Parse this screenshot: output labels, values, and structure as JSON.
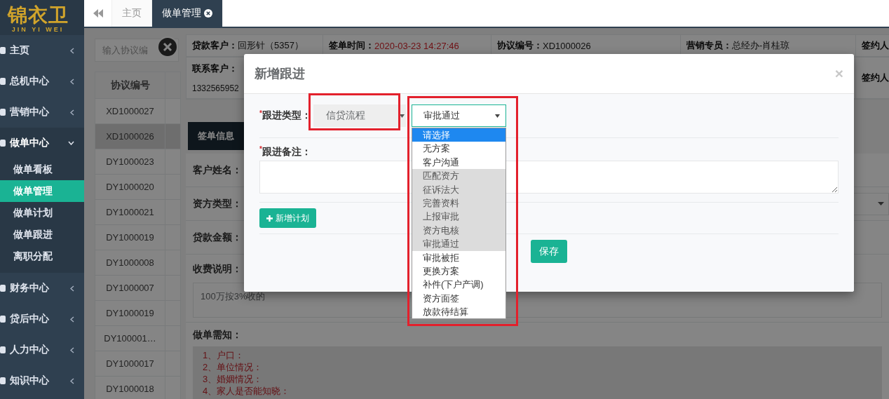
{
  "sidebar": {
    "logo": {
      "title": "锦衣卫",
      "subtitle": "JIN YI WEI"
    },
    "items": [
      {
        "label": "主页",
        "expanded": false
      },
      {
        "label": "总机中心",
        "expanded": false
      },
      {
        "label": "营销中心",
        "expanded": false
      },
      {
        "label": "做单中心",
        "expanded": true,
        "children": [
          {
            "label": "做单看板",
            "selected": false
          },
          {
            "label": "做单管理",
            "selected": true
          },
          {
            "label": "做单计划",
            "selected": false
          },
          {
            "label": "做单跟进",
            "selected": false
          },
          {
            "label": "离职分配",
            "selected": false
          }
        ]
      },
      {
        "label": "财务中心",
        "expanded": false
      },
      {
        "label": "贷后中心",
        "expanded": false
      },
      {
        "label": "人力中心",
        "expanded": false
      },
      {
        "label": "知识中心",
        "expanded": false
      }
    ]
  },
  "tabs": [
    {
      "label": "主页",
      "selected": false,
      "closable": false
    },
    {
      "label": "做单管理",
      "selected": true,
      "closable": true
    }
  ],
  "order_list": {
    "search": {
      "placeholder": "输入协议编"
    },
    "columns": [
      "协议编号"
    ],
    "rows": [
      {
        "number": "XD1000027",
        "selected": false
      },
      {
        "number": "XD1000026",
        "selected": true
      },
      {
        "number": "DY1000023",
        "selected": false
      },
      {
        "number": "DY1000020",
        "selected": false
      },
      {
        "number": "DY1000021",
        "selected": false
      },
      {
        "number": "DY1000019",
        "selected": false
      },
      {
        "number": "DY1000008",
        "selected": false
      },
      {
        "number": "DY1000007",
        "selected": false
      },
      {
        "number": "DY1000019",
        "selected": false
      },
      {
        "number": "DY100001…",
        "selected": false
      },
      {
        "number": "DY1000017",
        "selected": false
      },
      {
        "number": "DY1000018",
        "selected": false
      }
    ]
  },
  "detail": {
    "info_rows": [
      [
        {
          "label": "贷款客户：",
          "value": "回形针（5357）",
          "kind": "inline"
        },
        {
          "label": "签单时间：",
          "value": "2020-03-23 14:27:46",
          "kind": "alert"
        },
        {
          "label": "协议编号：",
          "value": "XD1000026",
          "kind": "inline"
        },
        {
          "label": "营销专员：",
          "value": "总经办-肖桂琼",
          "kind": "inline"
        },
        {
          "label": "签约人",
          "kind": "inline"
        }
      ],
      [
        {
          "label": "联系客户：",
          "value": "1332565952",
          "kind": "stacked"
        },
        {
          "label": "签约人",
          "kind": "inline"
        }
      ]
    ],
    "tab": "签单信息",
    "form": [
      {
        "label": "客户姓名：",
        "kind": "text"
      },
      {
        "label": "资方类型：",
        "kind": "select"
      },
      {
        "label": "贷款金额：",
        "kind": "text"
      },
      {
        "label": "收费说明：",
        "kind": "note",
        "value": "100万按3%收的"
      },
      {
        "label": "做单需知：",
        "kind": "list",
        "lines": [
          "1、户口：",
          "2、单位情况：",
          "3、婚姻情况：",
          "4、家人是否能知晓："
        ]
      }
    ]
  },
  "modal": {
    "title": "新增跟进",
    "close": "×",
    "type_field": {
      "required_mark": "*",
      "label": "跟进类型：",
      "type_select": {
        "value": "信贷流程",
        "disabled": true
      },
      "stage_select": {
        "value": "审批通过",
        "open": true,
        "options": [
          {
            "label": "请选择",
            "highlighted": true,
            "disabled": false
          },
          {
            "label": "无方案",
            "highlighted": false,
            "disabled": false
          },
          {
            "label": "客户沟通",
            "highlighted": false,
            "disabled": false
          },
          {
            "label": "匹配资方",
            "highlighted": false,
            "disabled": true
          },
          {
            "label": "征诉法大",
            "highlighted": false,
            "disabled": true
          },
          {
            "label": "完善资料",
            "highlighted": false,
            "disabled": true
          },
          {
            "label": "上报审批",
            "highlighted": false,
            "disabled": true
          },
          {
            "label": "资方电核",
            "highlighted": false,
            "disabled": true
          },
          {
            "label": "审批通过",
            "highlighted": false,
            "disabled": true
          },
          {
            "label": "审批被拒",
            "highlighted": false,
            "disabled": false
          },
          {
            "label": "更换方案",
            "highlighted": false,
            "disabled": false
          },
          {
            "label": "补件(下户产调)",
            "highlighted": false,
            "disabled": false
          },
          {
            "label": "资方面签",
            "highlighted": false,
            "disabled": false
          },
          {
            "label": "放款待结算",
            "highlighted": false,
            "disabled": false
          }
        ]
      }
    },
    "note_field": {
      "required_mark": "*",
      "label": "跟进备注："
    },
    "add_plan_button": {
      "label": "新增计划"
    },
    "save_button": {
      "label": "保存"
    }
  }
}
